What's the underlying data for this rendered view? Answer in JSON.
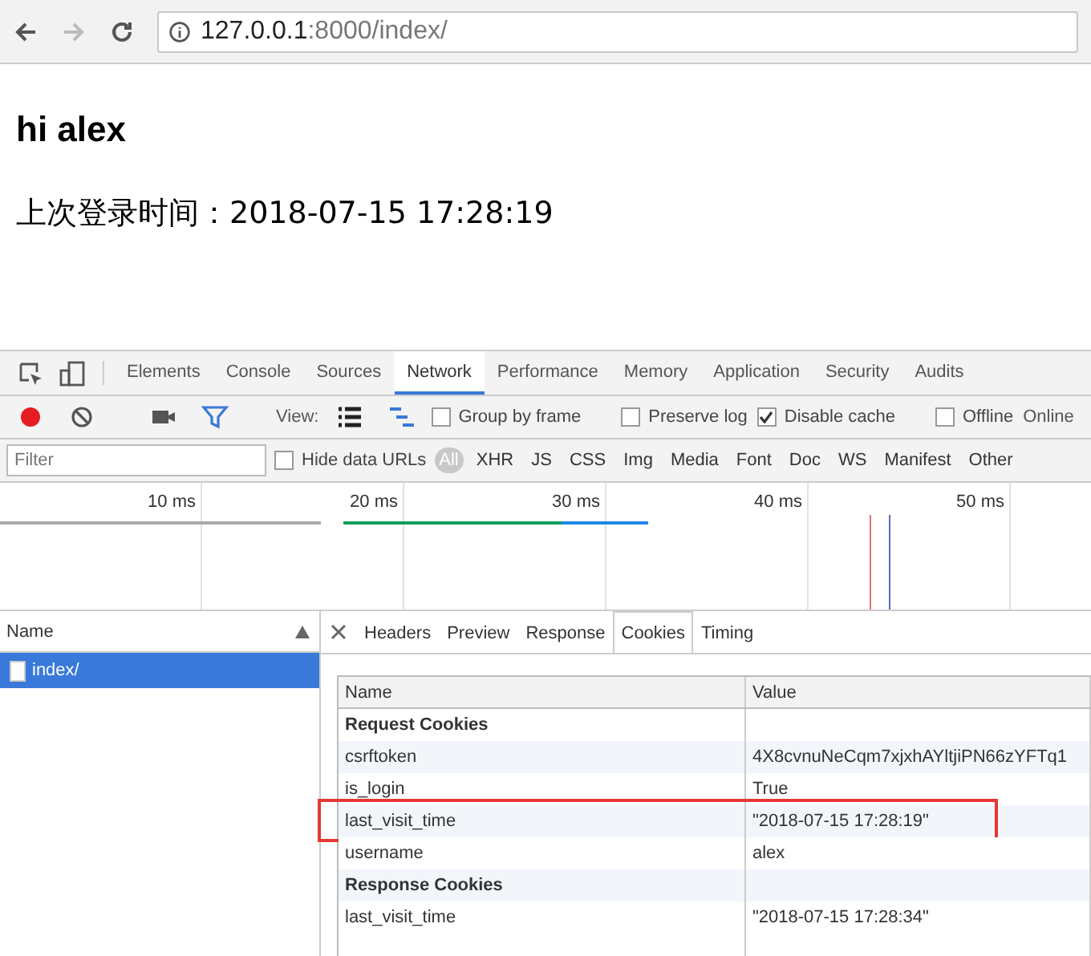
{
  "browser": {
    "address_host": "127.0.0.1",
    "address_rest": ":8000/index/"
  },
  "page": {
    "heading": "hi alex",
    "last_login": "上次登录时间：2018-07-15 17:28:19"
  },
  "devtools": {
    "tabs": [
      {
        "label": "Elements",
        "selected": false
      },
      {
        "label": "Console",
        "selected": false
      },
      {
        "label": "Sources",
        "selected": false
      },
      {
        "label": "Network",
        "selected": true
      },
      {
        "label": "Performance",
        "selected": false
      },
      {
        "label": "Memory",
        "selected": false
      },
      {
        "label": "Application",
        "selected": false
      },
      {
        "label": "Security",
        "selected": false
      },
      {
        "label": "Audits",
        "selected": false
      }
    ],
    "view_label": "View:",
    "options": [
      {
        "label": "Group by frame",
        "checked": false
      },
      {
        "label": "Preserve log",
        "checked": false
      },
      {
        "label": "Disable cache",
        "checked": true
      },
      {
        "label": "Offline",
        "checked": false
      }
    ],
    "throttle": "Online",
    "filter": {
      "placeholder": "Filter",
      "hide_data_urls": {
        "label": "Hide data URLs",
        "checked": false
      },
      "types": [
        {
          "label": "All",
          "selected": true
        },
        {
          "label": "XHR",
          "selected": false
        },
        {
          "label": "JS",
          "selected": false
        },
        {
          "label": "CSS",
          "selected": false
        },
        {
          "label": "Img",
          "selected": false
        },
        {
          "label": "Media",
          "selected": false
        },
        {
          "label": "Font",
          "selected": false
        },
        {
          "label": "Doc",
          "selected": false
        },
        {
          "label": "WS",
          "selected": false
        },
        {
          "label": "Manifest",
          "selected": false
        },
        {
          "label": "Other",
          "selected": false
        }
      ]
    },
    "overview_ticks": [
      "10 ms",
      "20 ms",
      "30 ms",
      "40 ms",
      "50 ms"
    ],
    "requests": {
      "column": "Name",
      "rows": [
        {
          "name": "index/",
          "selected": true
        }
      ]
    },
    "detail_tabs": [
      {
        "label": "Headers",
        "selected": false
      },
      {
        "label": "Preview",
        "selected": false
      },
      {
        "label": "Response",
        "selected": false
      },
      {
        "label": "Cookies",
        "selected": true
      },
      {
        "label": "Timing",
        "selected": false
      }
    ],
    "cookies": {
      "columns": [
        "Name",
        "Value"
      ],
      "rows": [
        {
          "kind": "section",
          "name": "Request Cookies",
          "highlighted": false
        },
        {
          "kind": "cookie",
          "name": "csrftoken",
          "value": "4X8cvnuNeCqm7xjxhAYltjiPN66zYFTq1",
          "highlighted": false
        },
        {
          "kind": "cookie",
          "name": "is_login",
          "value": "True",
          "highlighted": false
        },
        {
          "kind": "cookie",
          "name": "last_visit_time",
          "value": "\"2018-07-15 17:28:19\"",
          "highlighted": true
        },
        {
          "kind": "cookie",
          "name": "username",
          "value": "alex",
          "highlighted": false
        },
        {
          "kind": "section",
          "name": "Response Cookies",
          "highlighted": false
        },
        {
          "kind": "cookie",
          "name": "last_visit_time",
          "value": "\"2018-07-15 17:28:34\"",
          "highlighted": false
        }
      ]
    }
  }
}
